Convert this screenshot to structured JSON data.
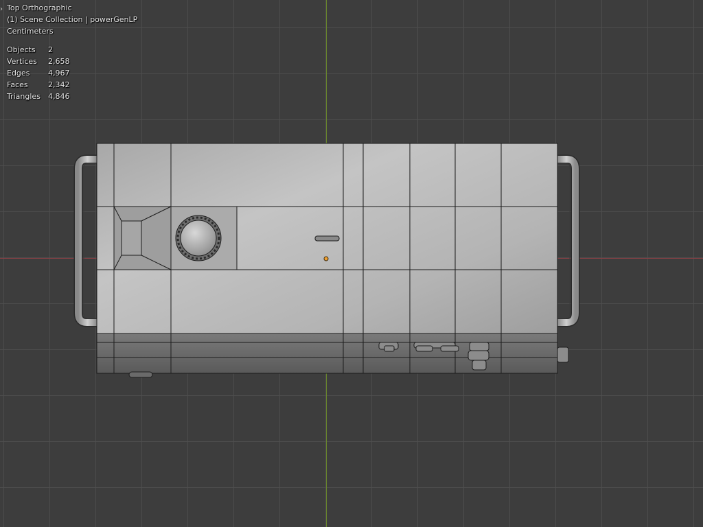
{
  "viewport": {
    "view_name": "Top Orthographic",
    "collection_label": "(1) Scene Collection | powerGenLP",
    "units": "Centimeters",
    "stats": [
      {
        "label": "Objects",
        "value": "2"
      },
      {
        "label": "Vertices",
        "value": "2,658"
      },
      {
        "label": "Edges",
        "value": "4,967"
      },
      {
        "label": "Faces",
        "value": "2,342"
      },
      {
        "label": "Triangles",
        "value": "4,846"
      }
    ]
  },
  "colors": {
    "background": "#3d3d3d",
    "grid": "#4e4e4e",
    "x_axis": "#8a3f45",
    "y_axis": "#6b8a2c",
    "origin": "#f0a030",
    "mesh_light": "#bdbdbd",
    "wireframe": "#1a1a1a"
  },
  "icons": {
    "collapse": "chevron-right-icon"
  }
}
